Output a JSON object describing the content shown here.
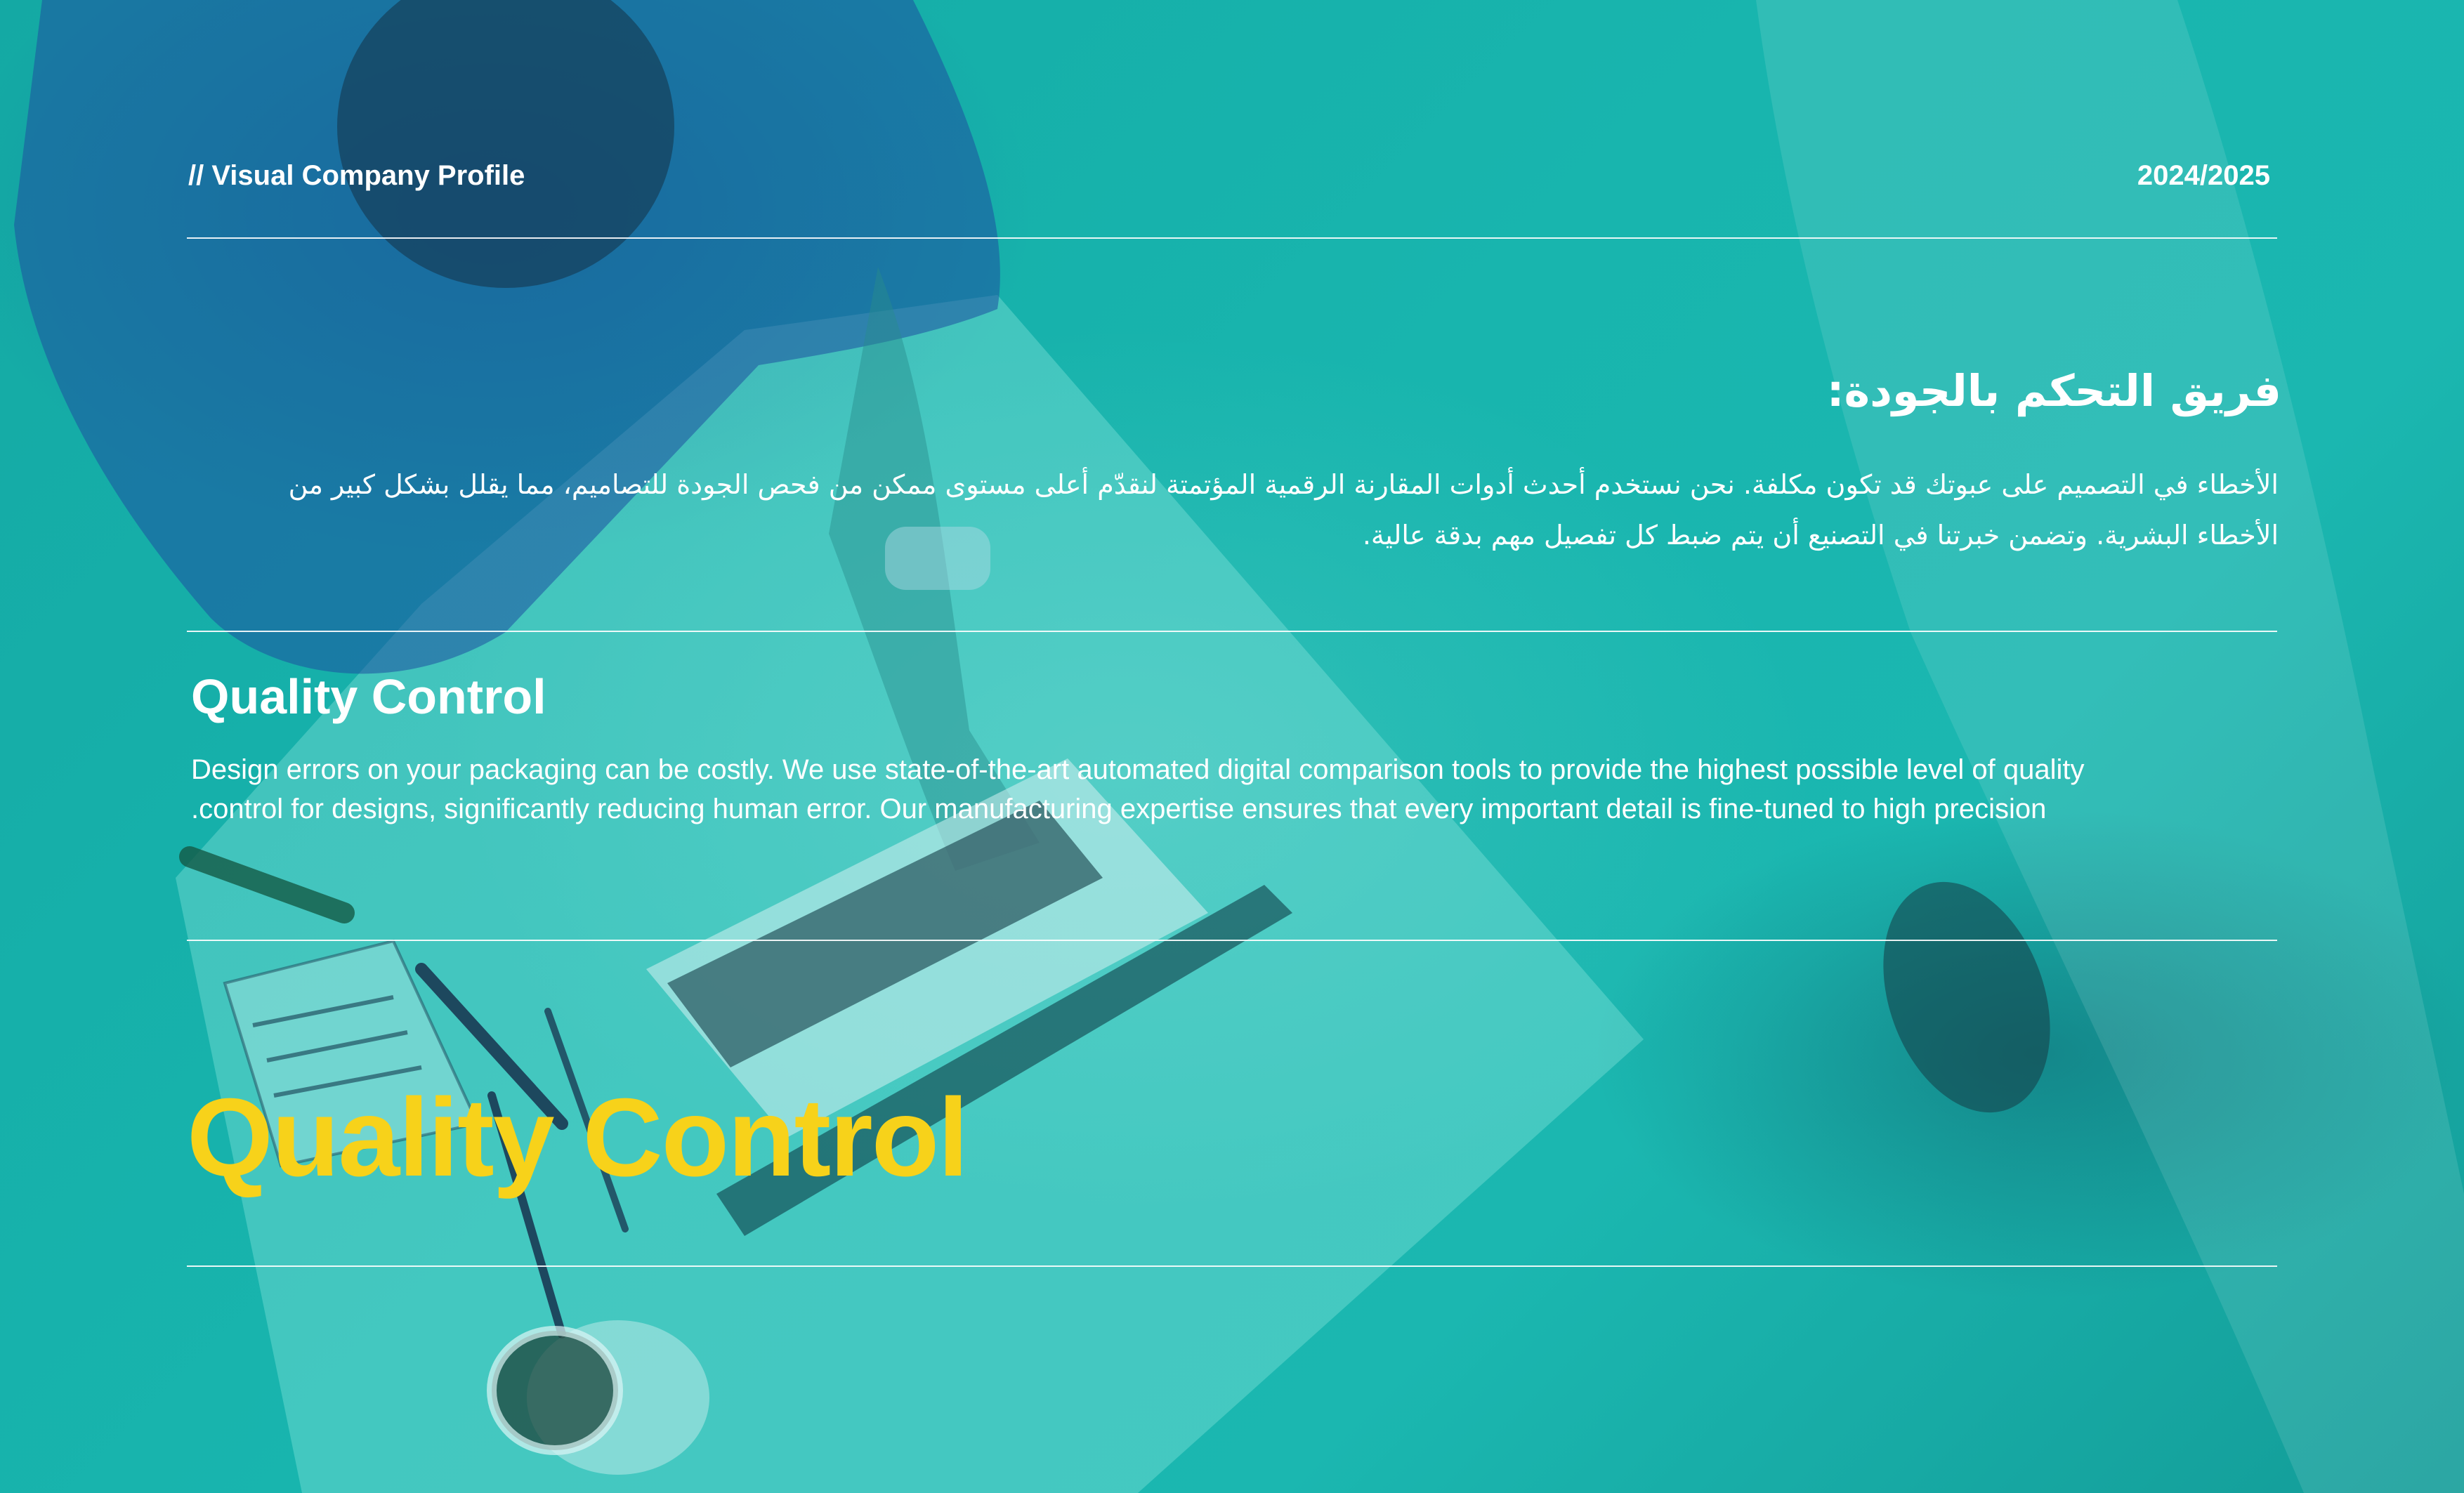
{
  "header": {
    "left_label": "// Visual Company Profile",
    "year": "2024/2025"
  },
  "arabic_section": {
    "title": "فريق التحكم بالجودة:",
    "body": "الأخطاء في التصميم على عبوتك قد تكون مكلفة. نحن نستخدم أحدث أدوات المقارنة الرقمية المؤتمتة لنقدّم أعلى مستوى ممكن من فحص الجودة للتصاميم، مما يقلل بشكل كبير من الأخطاء البشرية. وتضمن خبرتنا في التصنيع أن يتم ضبط كل تفصيل مهم بدقة عالية."
  },
  "english_section": {
    "title": "Quality Control",
    "line1": "Design errors on your packaging can be costly. We use state-of-the-art automated digital comparison tools to provide the highest possible level of quality",
    "line2": ".control for designs, significantly reducing human error. Our manufacturing expertise ensures that every important detail is fine-tuned to high precision"
  },
  "hero": {
    "title": "Quality Control"
  },
  "colors": {
    "background_teal": "#18b5ae",
    "accent_yellow": "#f7d21a",
    "text": "#ffffff"
  }
}
